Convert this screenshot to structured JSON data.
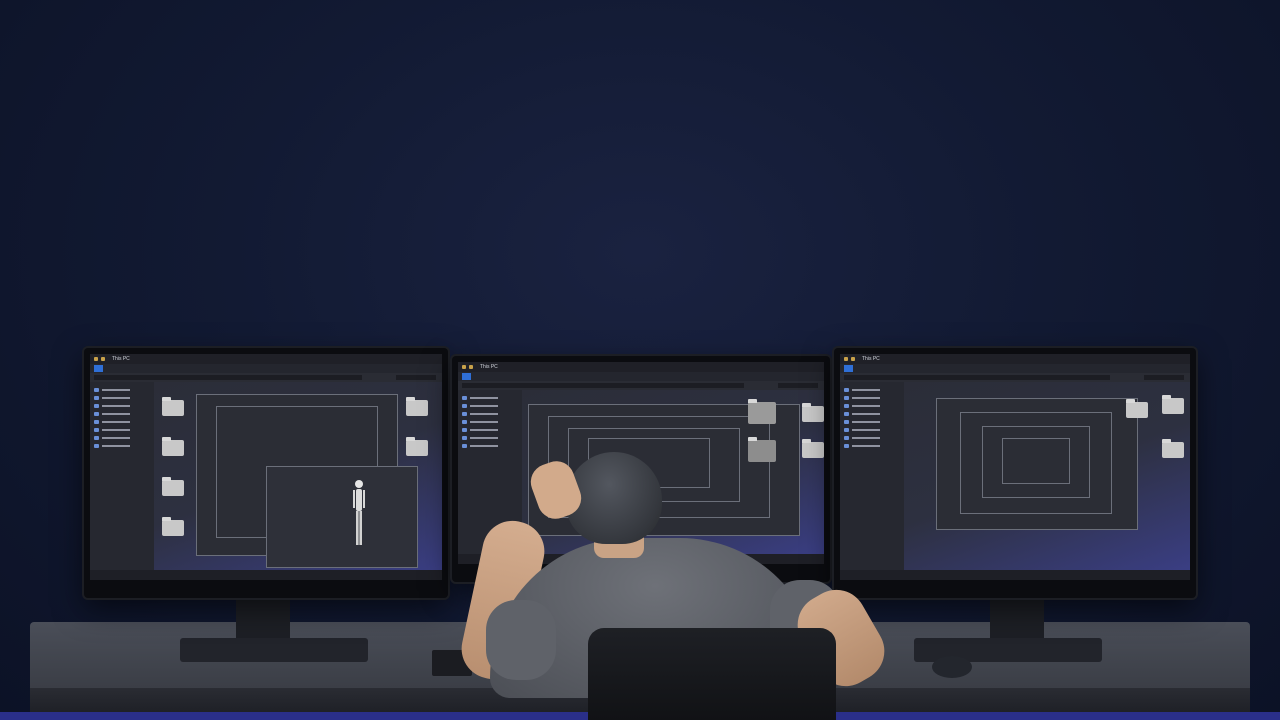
{
  "scene": {
    "description_free": true,
    "palette": {
      "background": "#121a33",
      "screen_glow": "#3b3f88",
      "desk": "#4a4e58",
      "ribbon_active": "#2f6fd6"
    }
  },
  "monitors": [
    {
      "id": "left",
      "window_title": "This PC"
    },
    {
      "id": "center",
      "window_title": "This PC"
    },
    {
      "id": "right",
      "window_title": "This PC"
    }
  ],
  "icons": {
    "folder": "folder-icon",
    "nav": "drive-icon",
    "figure": "mannequin-figure"
  }
}
